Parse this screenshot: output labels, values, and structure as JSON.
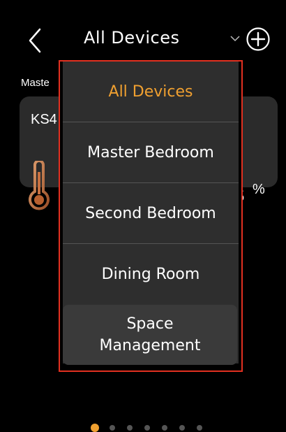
{
  "header": {
    "title": "All Devices",
    "back_icon": "chevron-left-icon",
    "dropdown_icon": "chevron-down-icon",
    "add_icon": "plus-circle-icon"
  },
  "background": {
    "room_label": "Maste",
    "device_name": "KS4",
    "digit_partial": "5",
    "unit": "%",
    "icon": "thermometer-icon"
  },
  "dropdown": {
    "items": [
      {
        "label": "All Devices",
        "active": true
      },
      {
        "label": "Master Bedroom",
        "active": false
      },
      {
        "label": "Second Bedroom",
        "active": false
      },
      {
        "label": "Dining Room",
        "active": false
      }
    ],
    "space_management": {
      "line1": "Space",
      "line2": "Management"
    }
  },
  "pagination": {
    "total": 7,
    "current": 1
  },
  "colors": {
    "accent": "#f0a030",
    "highlight_border": "#e23020",
    "card_bg": "#2b2b2b",
    "dropdown_bg": "#2e2e2e"
  }
}
